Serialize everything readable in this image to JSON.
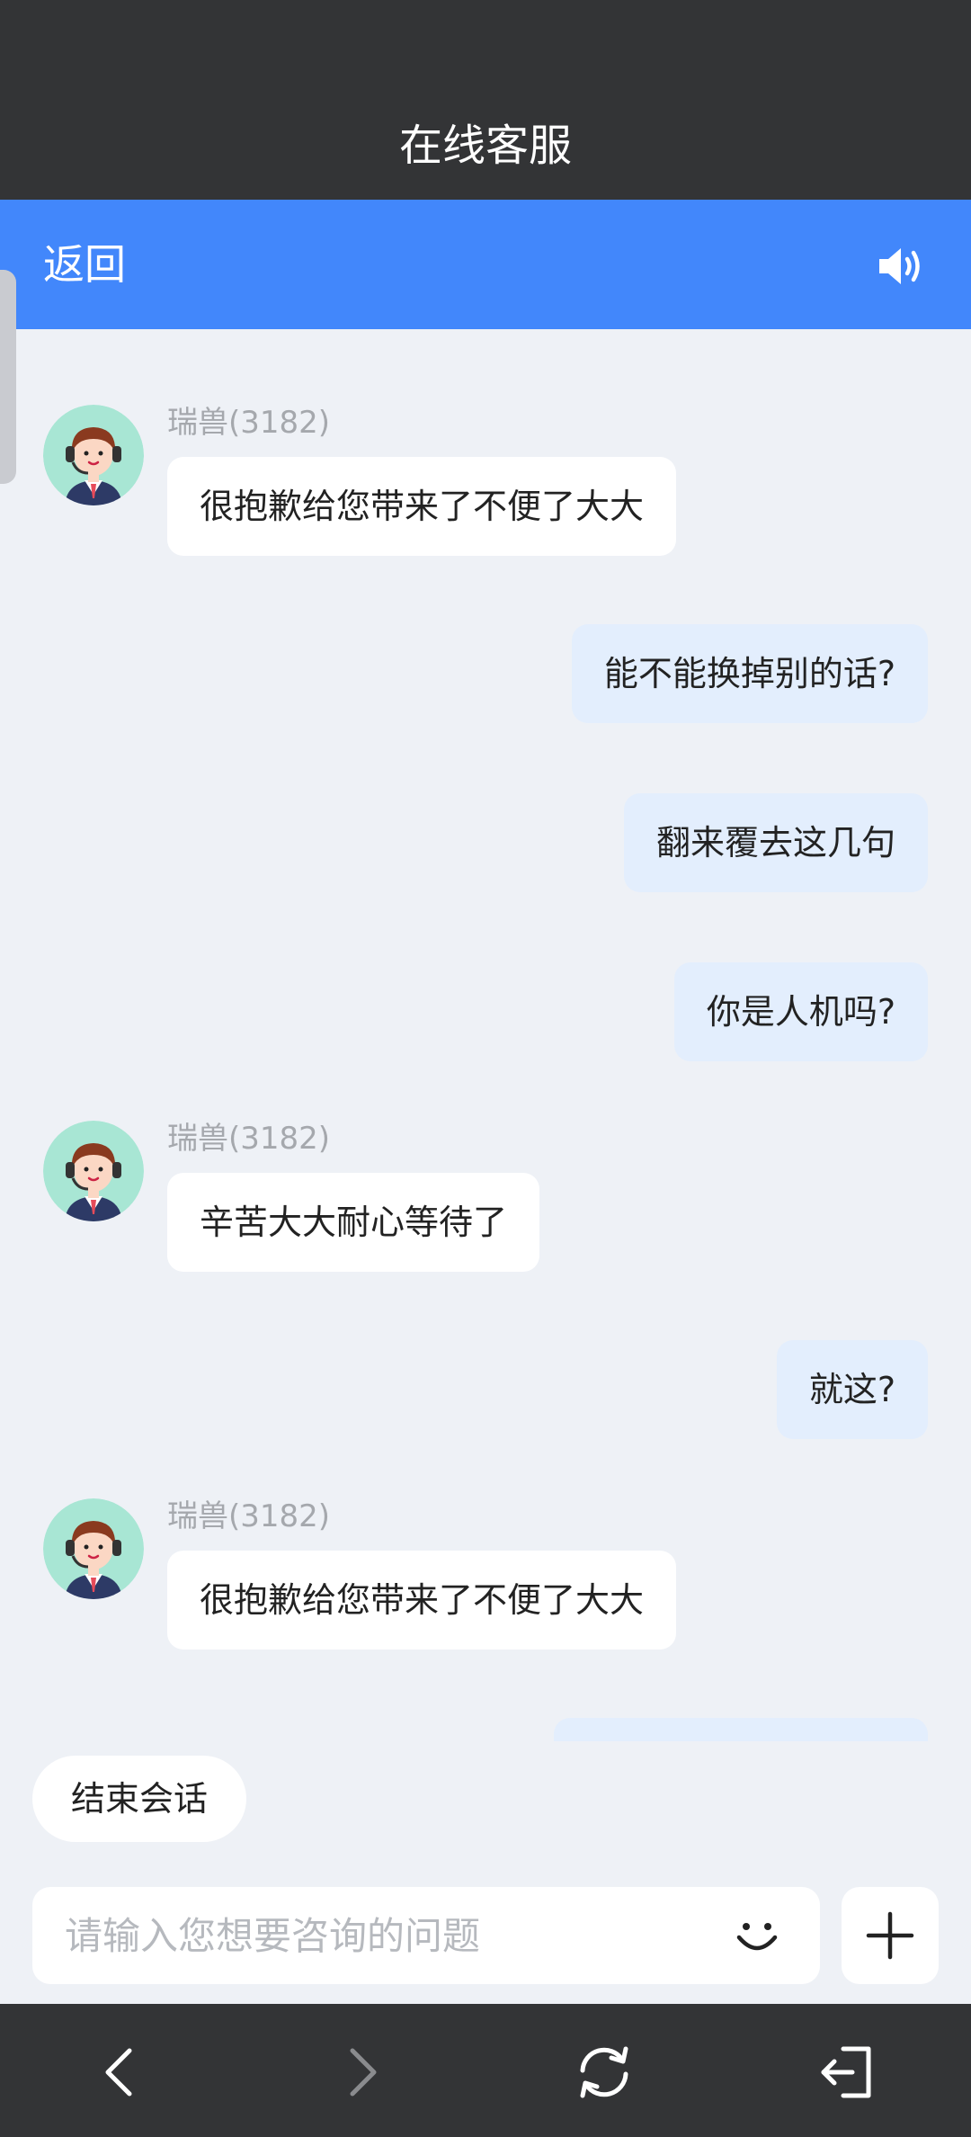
{
  "window": {
    "title": "在线客服"
  },
  "header": {
    "back_label": "返回",
    "speaker_icon": "speaker-icon"
  },
  "messages": [
    {
      "side": "agent",
      "sender": "瑞兽(3182)",
      "text": "很抱歉给您带来了不便了大大"
    },
    {
      "side": "user",
      "text": "能不能换掉别的话?"
    },
    {
      "side": "user",
      "text": "翻来覆去这几句"
    },
    {
      "side": "user",
      "text": "你是人机吗?"
    },
    {
      "side": "agent",
      "sender": "瑞兽(3182)",
      "text": "辛苦大大耐心等待了"
    },
    {
      "side": "user",
      "text": "就这?"
    },
    {
      "side": "agent",
      "sender": "瑞兽(3182)",
      "text": "很抱歉给您带来了不便了大大"
    }
  ],
  "actions": {
    "end_session_label": "结束会话"
  },
  "composer": {
    "placeholder": "请输入您想要咨询的问题",
    "emoji_icon": "smile-icon",
    "plus_icon": "plus-icon"
  },
  "nav": {
    "back_icon": "chevron-left-icon",
    "forward_icon": "chevron-right-icon",
    "refresh_icon": "refresh-icon",
    "exit_icon": "exit-icon"
  },
  "colors": {
    "title_bar": "#333436",
    "header_blue": "#4287fb",
    "chat_background": "#eef1f6",
    "user_bubble": "#e3eefd",
    "agent_bubble": "#ffffff",
    "avatar_background": "#a8e6d4"
  }
}
